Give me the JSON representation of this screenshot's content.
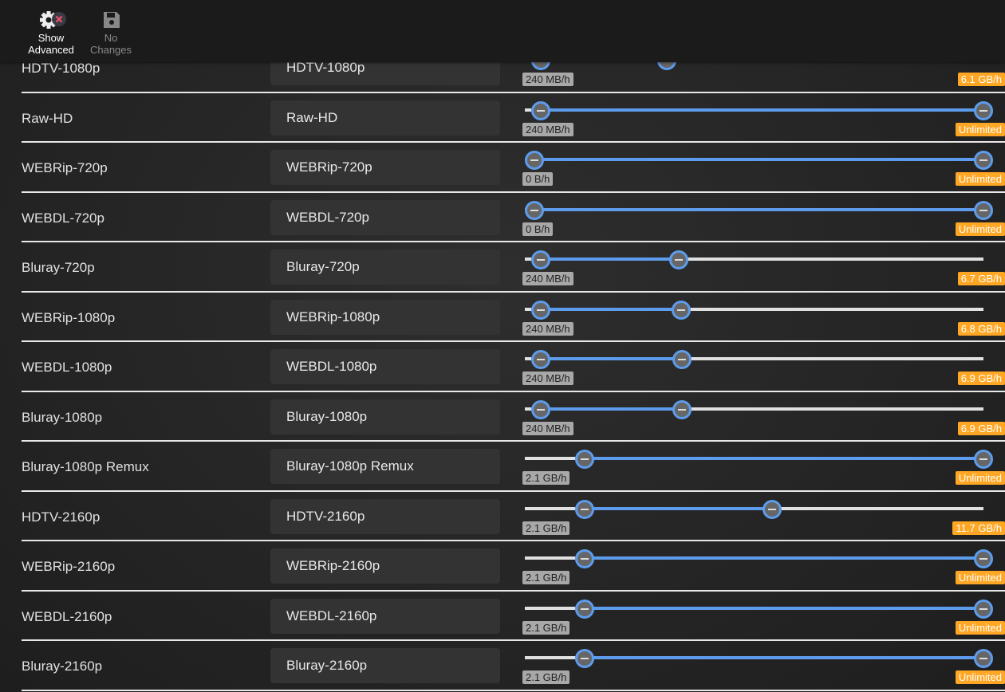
{
  "toolbar": {
    "show_advanced": {
      "line1": "Show",
      "line2": "Advanced",
      "icon": "gear-with-x-icon"
    },
    "no_changes": {
      "line1": "No",
      "line2": "Changes",
      "icon": "save-icon"
    }
  },
  "colors": {
    "accent": "#5d9cec",
    "max_badge": "#ffa724",
    "min_badge": "#a8a8a8"
  },
  "rows": [
    {
      "name": "HDTV-1080p",
      "title": "HDTV-1080p",
      "min": "240 MB/h",
      "max": "6.1 GB/h",
      "min_pct": 1.4,
      "max_pct": 29.5
    },
    {
      "name": "Raw-HD",
      "title": "Raw-HD",
      "min": "240 MB/h",
      "max": "Unlimited",
      "min_pct": 1.4,
      "max_pct": 100
    },
    {
      "name": "WEBRip-720p",
      "title": "WEBRip-720p",
      "min": "0 B/h",
      "max": "Unlimited",
      "min_pct": 0,
      "max_pct": 100
    },
    {
      "name": "WEBDL-720p",
      "title": "WEBDL-720p",
      "min": "0 B/h",
      "max": "Unlimited",
      "min_pct": 0,
      "max_pct": 100
    },
    {
      "name": "Bluray-720p",
      "title": "Bluray-720p",
      "min": "240 MB/h",
      "max": "6.7 GB/h",
      "min_pct": 1.4,
      "max_pct": 32.2
    },
    {
      "name": "WEBRip-1080p",
      "title": "WEBRip-1080p",
      "min": "240 MB/h",
      "max": "6.8 GB/h",
      "min_pct": 1.4,
      "max_pct": 32.7
    },
    {
      "name": "WEBDL-1080p",
      "title": "WEBDL-1080p",
      "min": "240 MB/h",
      "max": "6.9 GB/h",
      "min_pct": 1.4,
      "max_pct": 32.9
    },
    {
      "name": "Bluray-1080p",
      "title": "Bluray-1080p",
      "min": "240 MB/h",
      "max": "6.9 GB/h",
      "min_pct": 1.4,
      "max_pct": 32.9
    },
    {
      "name": "Bluray-1080p Remux",
      "title": "Bluray-1080p Remux",
      "min": "2.1 GB/h",
      "max": "Unlimited",
      "min_pct": 11,
      "max_pct": 100
    },
    {
      "name": "HDTV-2160p",
      "title": "HDTV-2160p",
      "min": "2.1 GB/h",
      "max": "11.7 GB/h",
      "min_pct": 11,
      "max_pct": 53
    },
    {
      "name": "WEBRip-2160p",
      "title": "WEBRip-2160p",
      "min": "2.1 GB/h",
      "max": "Unlimited",
      "min_pct": 11,
      "max_pct": 100
    },
    {
      "name": "WEBDL-2160p",
      "title": "WEBDL-2160p",
      "min": "2.1 GB/h",
      "max": "Unlimited",
      "min_pct": 11,
      "max_pct": 100
    },
    {
      "name": "Bluray-2160p",
      "title": "Bluray-2160p",
      "min": "2.1 GB/h",
      "max": "Unlimited",
      "min_pct": 11,
      "max_pct": 100
    }
  ]
}
